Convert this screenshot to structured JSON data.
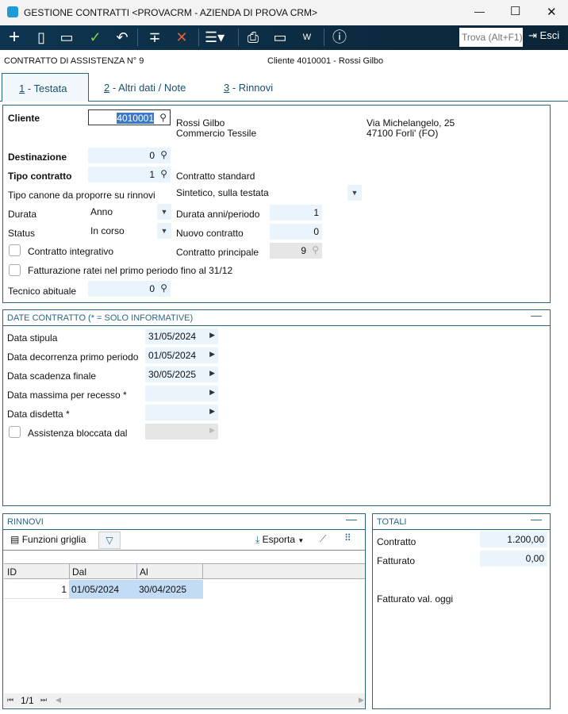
{
  "window": {
    "title": "GESTIONE CONTRATTI <PROVACRM - AZIENDA DI PROVA CRM>",
    "minimize": "—",
    "maximize": "☐",
    "close": "✕"
  },
  "toolbar": {
    "search_placeholder": "Trova (Alt+F1)",
    "exit_label": "Esci"
  },
  "header": {
    "contract": "CONTRATTO DI ASSISTENZA N° 9",
    "client": "Cliente 4010001 - Rossi Gilbo"
  },
  "tabs": [
    {
      "num": "1",
      "label": " - Testata"
    },
    {
      "num": "2",
      "label": " - Altri dati / Note"
    },
    {
      "num": "3",
      "label": " - Rinnovi"
    }
  ],
  "testata": {
    "cliente_label": "Cliente",
    "cliente_value": "4010001",
    "cliente_name": "Rossi Gilbo",
    "cliente_desc": "Commercio Tessile",
    "address1": "Via Michelangelo, 25",
    "address2": "47100 Forli' (FO)",
    "destinazione_label": "Destinazione",
    "destinazione_value": "0",
    "tipo_label": "Tipo contratto",
    "tipo_value": "1",
    "tipo_desc": "Contratto standard",
    "canone_label": "Tipo canone da proporre su rinnovi",
    "canone_value": "Sintetico, sulla testata",
    "durata_label": "Durata",
    "durata_value": "Anno",
    "durata_anni_label": "Durata anni/periodo",
    "durata_anni_value": "1",
    "status_label": "Status",
    "status_value": "In corso",
    "nuovo_label": "Nuovo contratto",
    "nuovo_value": "0",
    "integrativo_label": "Contratto integrativo",
    "principale_label": "Contratto principale",
    "principale_value": "9",
    "ratei_label": "Fatturazione ratei nel primo periodo fino al 31/12",
    "tecnico_label": "Tecnico abituale",
    "tecnico_value": "0"
  },
  "date": {
    "title": "DATE CONTRATTO (* = SOLO INFORMATIVE)",
    "rows": [
      {
        "label": "Data stipula",
        "value": "31/05/2024"
      },
      {
        "label": "Data decorrenza primo periodo",
        "value": "01/05/2024"
      },
      {
        "label": "Data scadenza finale",
        "value": "30/05/2025"
      },
      {
        "label": "Data massima per recesso *",
        "value": ""
      },
      {
        "label": "Data disdetta *",
        "value": ""
      }
    ],
    "bloccata_label": "Assistenza bloccata dal"
  },
  "rinnovi": {
    "title": "RINNOVI",
    "funzioni": "Funzioni griglia",
    "esporta": "Esporta",
    "columns": [
      "ID",
      "Dal",
      "Al"
    ],
    "rows": [
      [
        "1",
        "01/05/2024",
        "30/04/2025"
      ]
    ],
    "pager": "1/1"
  },
  "totali": {
    "title": "TOTALI",
    "contratto_label": "Contratto",
    "contratto_value": "1.200,00",
    "fatturato_label": "Fatturato",
    "fatturato_value": "0,00",
    "oggi_label": "Fatturato val. oggi"
  }
}
